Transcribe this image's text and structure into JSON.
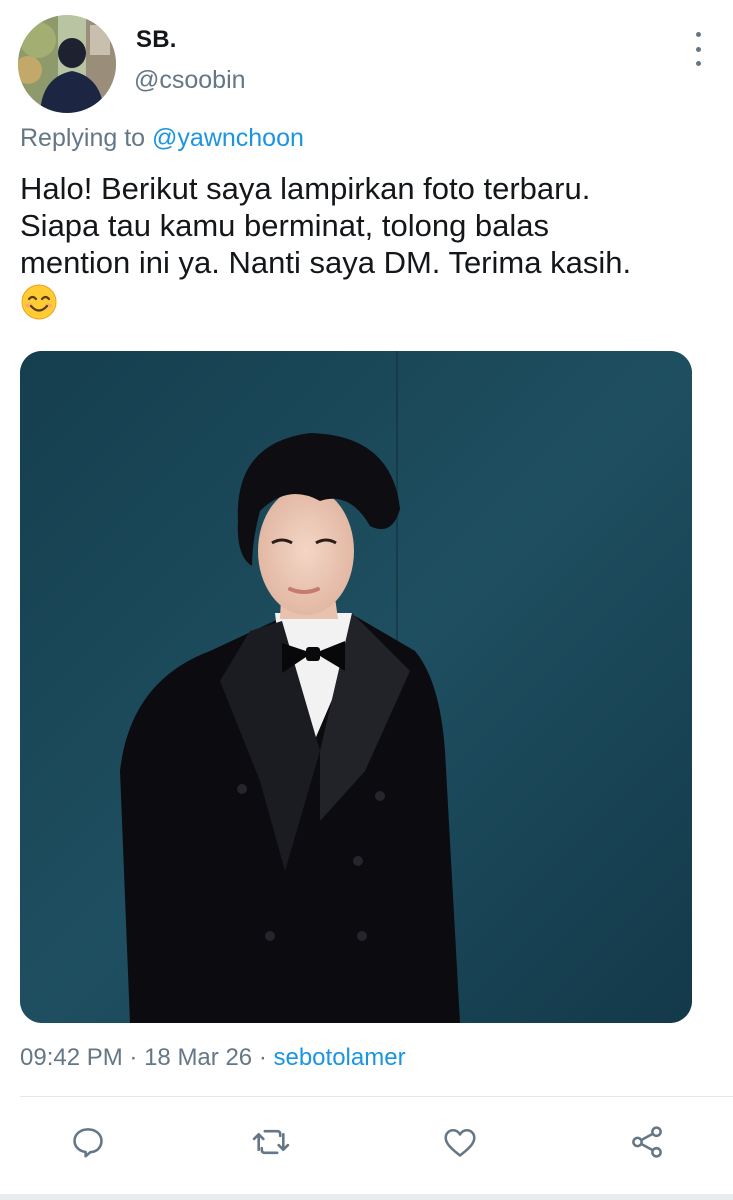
{
  "user": {
    "display_name": "SB.",
    "handle": "@csoobin"
  },
  "reply": {
    "prefix": "Replying to",
    "mention": "@yawnchoon"
  },
  "tweet": {
    "lines": [
      "Halo! Berikut saya lampirkan foto terbaru.",
      "Siapa tau kamu berminat, tolong balas",
      "mention ini ya. Nanti saya DM. Terima kasih."
    ],
    "emoji": "smiling-face-with-smiling-eyes"
  },
  "meta": {
    "time": "09:42 PM",
    "separator": "·",
    "date": "18 Mar 26",
    "source": "sebotolamer"
  },
  "actions": {
    "icons": [
      "reply-icon",
      "retweet-icon",
      "like-icon",
      "share-icon"
    ]
  },
  "colors": {
    "link": "#1b95e0",
    "secondary_text": "#657786",
    "primary_text": "#14171a",
    "photo_background": "#1d4a5a"
  }
}
